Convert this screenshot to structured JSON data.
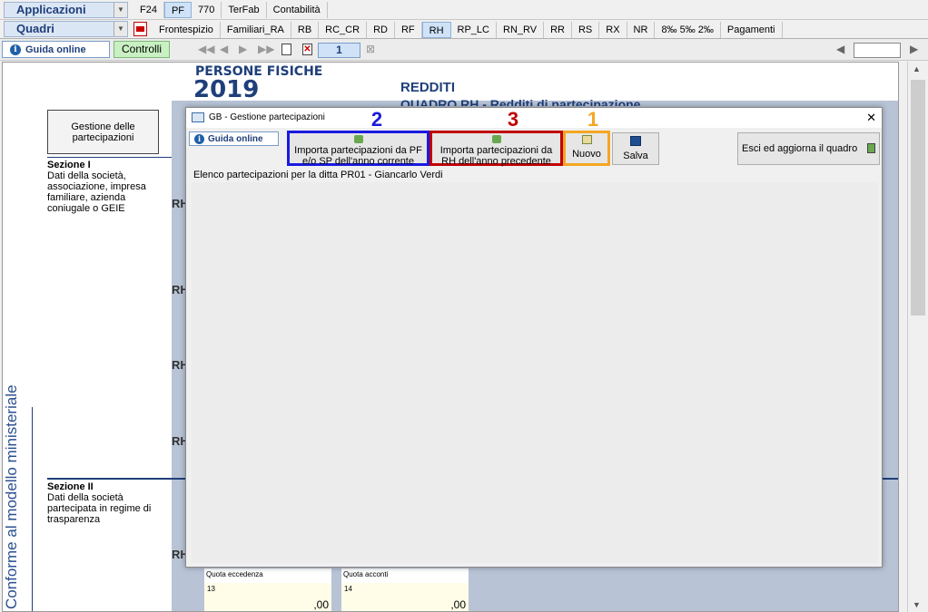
{
  "toolbar": {
    "applicazioni_label": "Applicazioni",
    "quadri_label": "Quadri",
    "top_tabs": [
      "F24",
      "PF",
      "770",
      "TerFab",
      "Contabilità"
    ],
    "quadri_tabs": [
      "Frontespizio",
      "Familiari_RA",
      "RB",
      "RC_CR",
      "RD",
      "RF",
      "RH",
      "RP_LC",
      "RN_RV",
      "RR",
      "RS",
      "RX",
      "NR",
      "8‰ 5‰ 2‰",
      "Pagamenti"
    ],
    "guida_online": "Guida online",
    "controlli": "Controlli",
    "page_number": "1"
  },
  "document": {
    "header_title": "PERSONE FISICHE",
    "header_year": "2019",
    "redditi": "REDDITI",
    "quadro": "QUADRO RH - Redditi di partecipazione",
    "gestione_button": "Gestione delle partecipazioni",
    "sezione1_title": "Sezione I",
    "sezione1_desc": "Dati della società, associazione, impresa familiare, azienda coniugale o GEIE",
    "sezione2_title": "Sezione II",
    "sezione2_desc": "Dati della società partecipata in regime di trasparenza",
    "row_label": "RH",
    "side_text": "Conforme al modello ministeriale",
    "quota_eccedenza": "Quota eccedenza",
    "quota_acconti": "Quota acconti",
    "field13": "13",
    "field14": "14",
    "amount": ",00"
  },
  "dialog": {
    "title": "GB - Gestione partecipazioni",
    "guida_online": "Guida online",
    "import_pf_sp": "Importa partecipazioni da PF e/o SP dell'anno corrente",
    "import_rh": "Importa partecipazioni da RH dell'anno precedente",
    "nuovo": "Nuovo",
    "salva": "Salva",
    "esci": "Esci ed aggiorna il quadro",
    "list_caption": "Elenco partecipazioni per la ditta PR01 - Giancarlo Verdi",
    "close": "✕"
  },
  "annotations": {
    "n1": "1",
    "n2": "2",
    "n3": "3",
    "color1": "#f5a623",
    "color2": "#1a1adf",
    "color3": "#c00000"
  }
}
